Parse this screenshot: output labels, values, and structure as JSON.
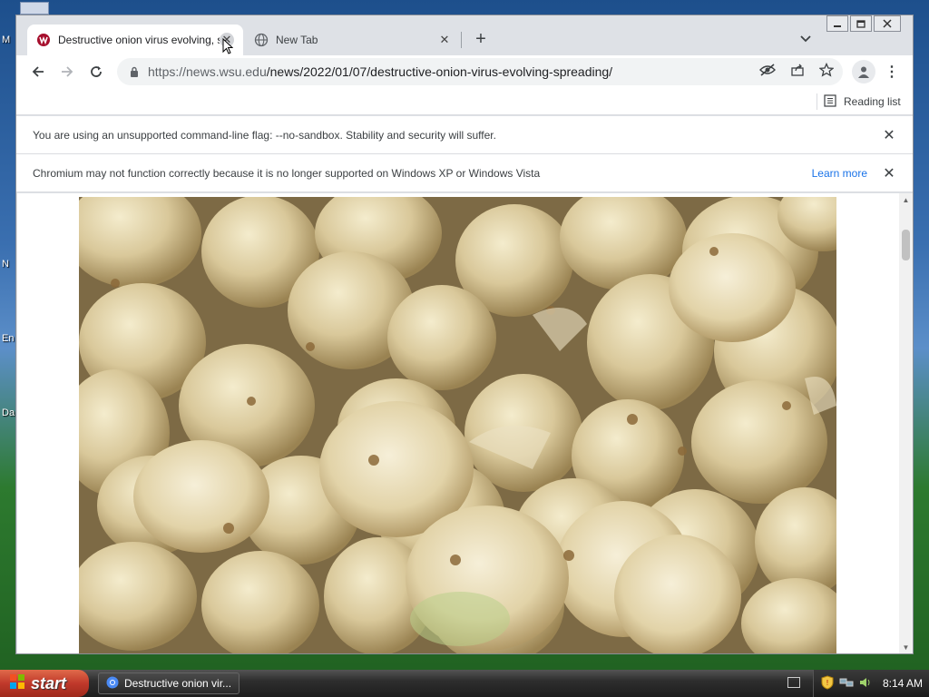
{
  "desktop": {
    "fragments": [
      "M",
      "N",
      "En",
      "Da"
    ]
  },
  "browser": {
    "tabs": [
      {
        "title": "Destructive onion virus evolving, sp",
        "active": true
      },
      {
        "title": "New Tab",
        "active": false
      }
    ],
    "window_controls": [
      "minimize",
      "restore",
      "close"
    ],
    "url": {
      "host": "https://news.wsu.edu",
      "path": "/news/2022/01/07/destructive-onion-virus-evolving-spreading/"
    },
    "reading_list_label": "Reading list",
    "infobars": [
      {
        "message": "You are using an unsupported command-line flag: --no-sandbox. Stability and security will suffer.",
        "link": ""
      },
      {
        "message": "Chromium may not function correctly because it is no longer supported on Windows XP or Windows Vista",
        "link": "Learn more"
      }
    ]
  },
  "taskbar": {
    "start_label": "start",
    "task_item_label": "Destructive onion vir...",
    "clock": "8:14 AM"
  },
  "colors": {
    "link": "#1a73e8",
    "wsu_crimson": "#a60f2d",
    "start_red": "#c0392b"
  }
}
